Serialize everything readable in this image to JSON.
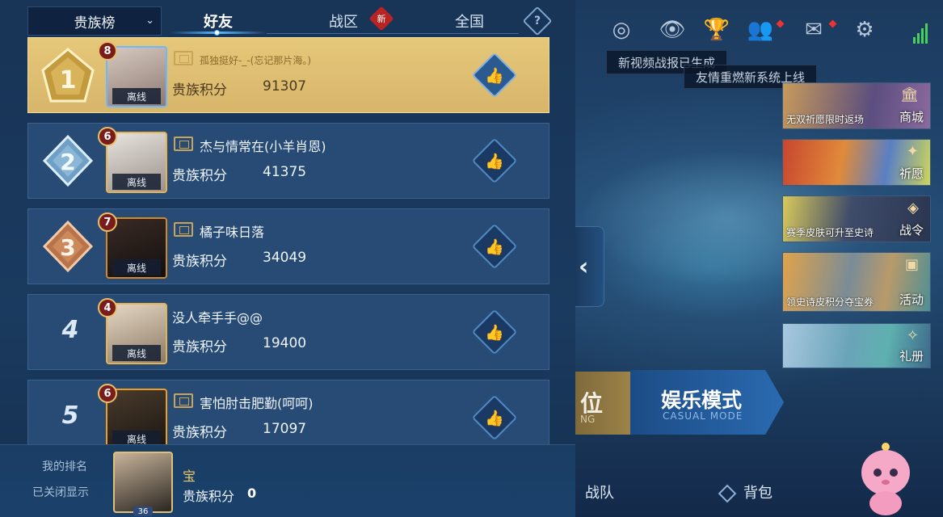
{
  "header": {
    "dropdown_label": "贵族榜",
    "dropdown_chevron": "⌄",
    "tabs": {
      "friends": "好友",
      "region": "战区",
      "national": "全国"
    },
    "new_badge": "新",
    "help_glyph": "?"
  },
  "rows": [
    {
      "rank": "1",
      "level": "8",
      "status": "离线",
      "nickname": "孤独挺好-_-(忘记那片海。)",
      "score_label": "贵族积分",
      "score": "91307"
    },
    {
      "rank": "2",
      "level": "6",
      "status": "离线",
      "nickname": "杰与情常在(小羊肖恩)",
      "score_label": "贵族积分",
      "score": "41375"
    },
    {
      "rank": "3",
      "level": "7",
      "status": "离线",
      "nickname": "橘子味日落",
      "score_label": "贵族积分",
      "score": "34049"
    },
    {
      "rank": "4",
      "level": "4",
      "status": "离线",
      "nickname": "没人牵手手@@",
      "score_label": "贵族积分",
      "score": "19400"
    },
    {
      "rank": "5",
      "level": "6",
      "status": "离线",
      "nickname": "害怕肘击肥勤(呵呵)",
      "score_label": "贵族积分",
      "score": "17097"
    }
  ],
  "like_glyph": "👍",
  "my_rank": {
    "label": "我的排名",
    "hidden_text": "已关闭显示",
    "name": "宝",
    "score_label": "贵族积分",
    "score": "0",
    "level": "36"
  },
  "collapse_glyph": "‹",
  "toasts": {
    "video": "新视频战报已生成",
    "friendship": "友情重燃新系统上线"
  },
  "top_icons": {
    "record": "◎",
    "eye": "👁",
    "trophy": "🏆",
    "friends": "👥",
    "mail": "✉",
    "settings": "⚙"
  },
  "promos": [
    {
      "caption": "无双祈愿限时返场",
      "label": "商城",
      "icon": "🏛"
    },
    {
      "caption": "",
      "label": "祈愿",
      "icon": "✦"
    },
    {
      "caption": "赛季皮肤可升至史诗",
      "label": "战令",
      "icon": "◈"
    },
    {
      "caption": "领史诗皮积分夺宝券",
      "label": "活动",
      "icon": "▣"
    },
    {
      "caption": "",
      "label": "礼册",
      "icon": "✧"
    }
  ],
  "modes": {
    "ranked_partial": "位",
    "ranked_sub": "NG",
    "casual": "娱乐模式",
    "casual_sub": "CASUAL MODE"
  },
  "bottom_nav": {
    "team": "战队",
    "bag": "背包"
  },
  "colors": {
    "first_row_gold": "#e6c87a",
    "row_blue": "#274b75",
    "accent_blue": "#5cb8ff",
    "my_name_gold": "#e9c86d",
    "new_badge_red": "#b82424"
  }
}
